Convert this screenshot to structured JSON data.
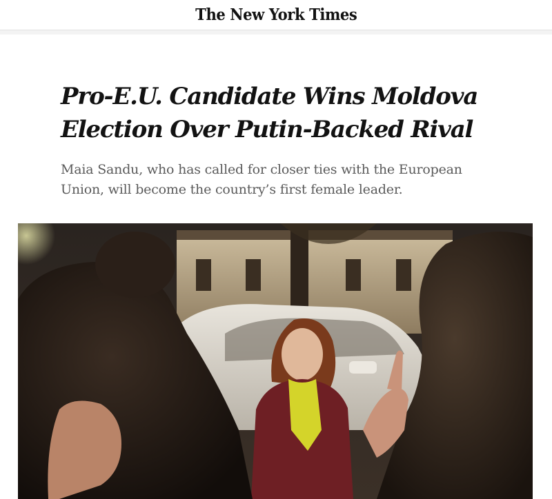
{
  "masthead": {
    "logo_text": "The New York Times"
  },
  "article": {
    "headline": "Pro-E.U. Candidate Wins Moldova Election Over Putin-Backed Rival",
    "summary": "Maia Sandu, who has called for closer ties with the European Union, will become the country’s first female leader."
  },
  "photo": {
    "icon": "photo-image"
  },
  "colors": {
    "text": "#121212",
    "summary": "#5a5a5a",
    "scarf": "#d4d42a",
    "coat": "#6e1f24"
  }
}
